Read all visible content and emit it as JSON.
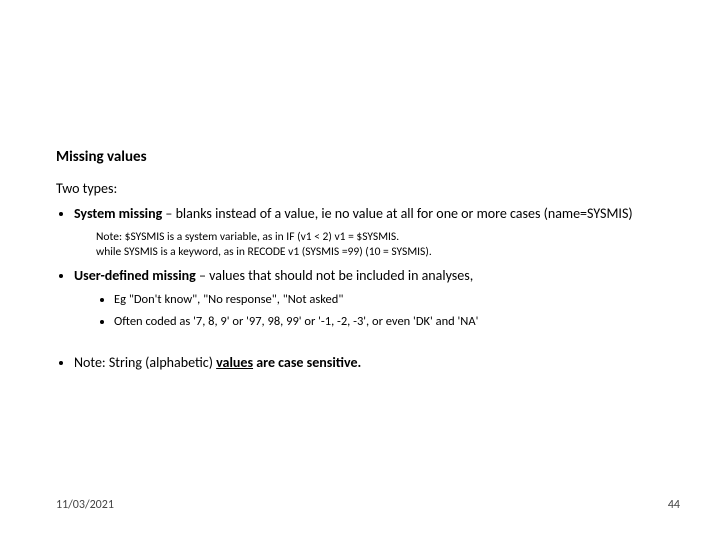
{
  "title": "Missing values",
  "intro": "Two types:",
  "bullets": {
    "system": {
      "label": "System missing",
      "rest": " – blanks instead of a value, ie no value at all for one or more cases (name=SYSMIS)",
      "note_line1": "Note: $SYSMIS is a system variable, as in IF (v1 < 2) v1 = $SYSMIS.",
      "note_line2": "while SYSMIS is a keyword, as in RECODE v1 (SYSMIS =99) (10 = SYSMIS)."
    },
    "user": {
      "label": "User-defined missing",
      "rest": " – values that should not be included in analyses,",
      "sub1": "Eg \"Don't know\", \"No response\", \"Not asked\"",
      "sub2": "Often coded as '7, 8, 9' or '97, 98, 99' or '-1, -2, -3', or even 'DK' and 'NA'"
    },
    "note_string": {
      "pre": "Note: String (alphabetic) ",
      "underlined": "values",
      "post": " are case sensitive."
    }
  },
  "footer": {
    "date": "11/03/2021",
    "page": "44"
  }
}
